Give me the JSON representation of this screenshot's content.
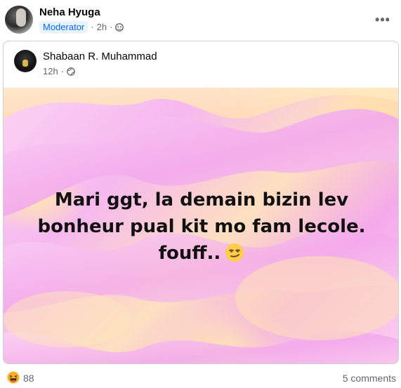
{
  "post": {
    "author": "Neha Hyuga",
    "badge": "Moderator",
    "time": "2h",
    "separator": "·",
    "privacy_icon": "group-icon",
    "more_icon": "more-options-icon",
    "more_label": "•••"
  },
  "shared": {
    "author": "Shabaan R. Muhammad",
    "time": "12h",
    "separator": "·",
    "privacy_icon": "globe-icon",
    "text": "Mari ggt, la demain bizin lev\nbonheur pual kit mo fam lecole.\nfouff..",
    "emoji": "smirk-emoji",
    "background_colors": [
      "#f6b8ef",
      "#fde0c0",
      "#ffe7b0"
    ]
  },
  "footer": {
    "reaction_icon": "laugh-reaction-icon",
    "reaction_count": "88",
    "comments": "5 comments"
  }
}
